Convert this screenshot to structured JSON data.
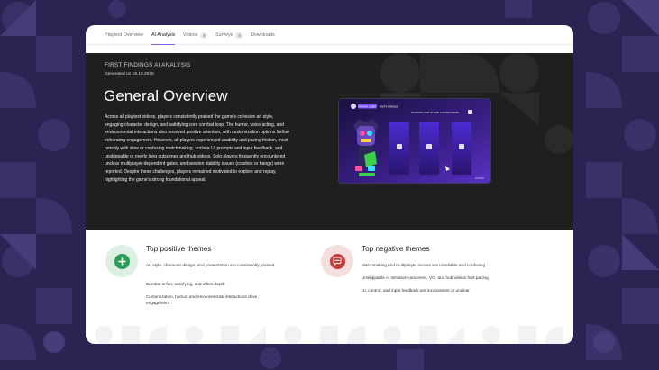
{
  "tabs": [
    {
      "label": "Playtest Overview",
      "badge": ""
    },
    {
      "label": "AI Analysis",
      "badge": ""
    },
    {
      "label": "Videos",
      "badge": "4"
    },
    {
      "label": "Surveys",
      "badge": "4"
    },
    {
      "label": "Downloads",
      "badge": ""
    }
  ],
  "active_tab": "AI Analysis",
  "hero": {
    "eyebrow": "FIRST FINDINGS AI ANALYSIS",
    "generated": "Generated on 18.10.2025",
    "title": "General Overview",
    "summary": "Across all playtest videos, players consistently praised the game's cohesive art style, engaging character design, and satisfying core combat loop. The humor, voice acting, and environmental interactions also received positive attention, with customization options further enhancing engagement. However, all players experienced usability and pacing friction, most notably with slow or confusing matchmaking, unclear UI prompts and input feedback, and unskippable or overly long cutscenes and hub videos. Solo players frequently encountered unclear multiplayer-dependent gates, and session stability issues (crashes or hangs) were reported. Despite these challenges, players remained motivated to explore and replay, highlighting the game's strong foundational appeal."
  },
  "video": {
    "lobby_status": "WAITING FOR OTHER CONTENDERS...",
    "tag_1": "PRIVATE LOBBY",
    "tag_2": "INVITE FRIENDS",
    "watermark": "ROOMS"
  },
  "positive": {
    "title": "Top positive themes",
    "items": [
      "Art style, character design, and presentation are consistently praised",
      "Combat is fun, satisfying, and offers depth",
      "Customization, humor, and environmental interactions drive engagement"
    ],
    "accent": "#2e9b5b",
    "accent_bg": "#dcefe3"
  },
  "negative": {
    "title": "Top negative themes",
    "items": [
      "Matchmaking and multiplayer access are unreliable and confusing",
      "Unskippable or intrusive cutscenes, VO, and hub videos hurt pacing",
      "UI, control, and input feedback are inconsistent or unclear"
    ],
    "accent": "#c73a3a",
    "accent_bg": "#f4dede"
  },
  "colors": {
    "page_bg": "#2b2453",
    "active_tab_underline": "#7a5cff",
    "hero_bg": "#1f1f1f"
  }
}
